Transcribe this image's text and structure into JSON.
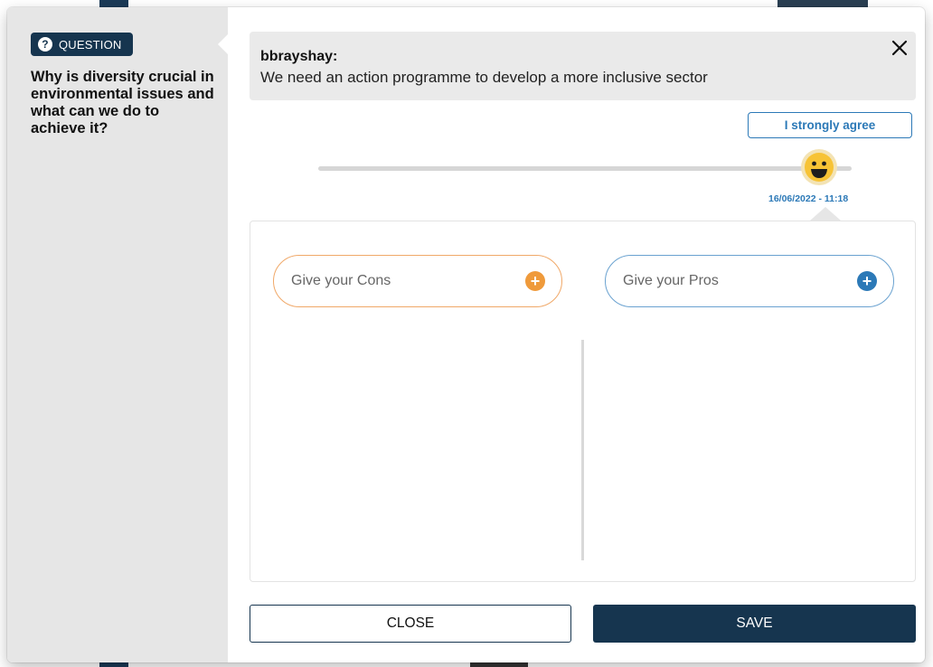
{
  "question": {
    "badge_label": "QUESTION",
    "badge_icon": "question-circle-icon",
    "text": "Why is diversity crucial in environmental issues and what can we do to achieve it?"
  },
  "comment": {
    "author": "bbrayshay:",
    "text": "We need an action programme to develop a more inclusive sector",
    "close_icon": "close-icon"
  },
  "opinion": {
    "label": "I strongly agree",
    "level": 0.95,
    "thumb_icon": "smiley-face-icon",
    "date": "16/06/2022 - 11:18"
  },
  "arguments": {
    "cons_placeholder": "Give your Cons",
    "pros_placeholder": "Give your Pros",
    "plus_symbol": "+"
  },
  "footer": {
    "close_label": "CLOSE",
    "save_label": "SAVE"
  },
  "colors": {
    "navy": "#16354f",
    "blue_accent": "#2c79b7",
    "orange_accent": "#ef9a3b",
    "panel_gray": "#e6e6e6",
    "smiley_yellow": "#f7c335"
  }
}
